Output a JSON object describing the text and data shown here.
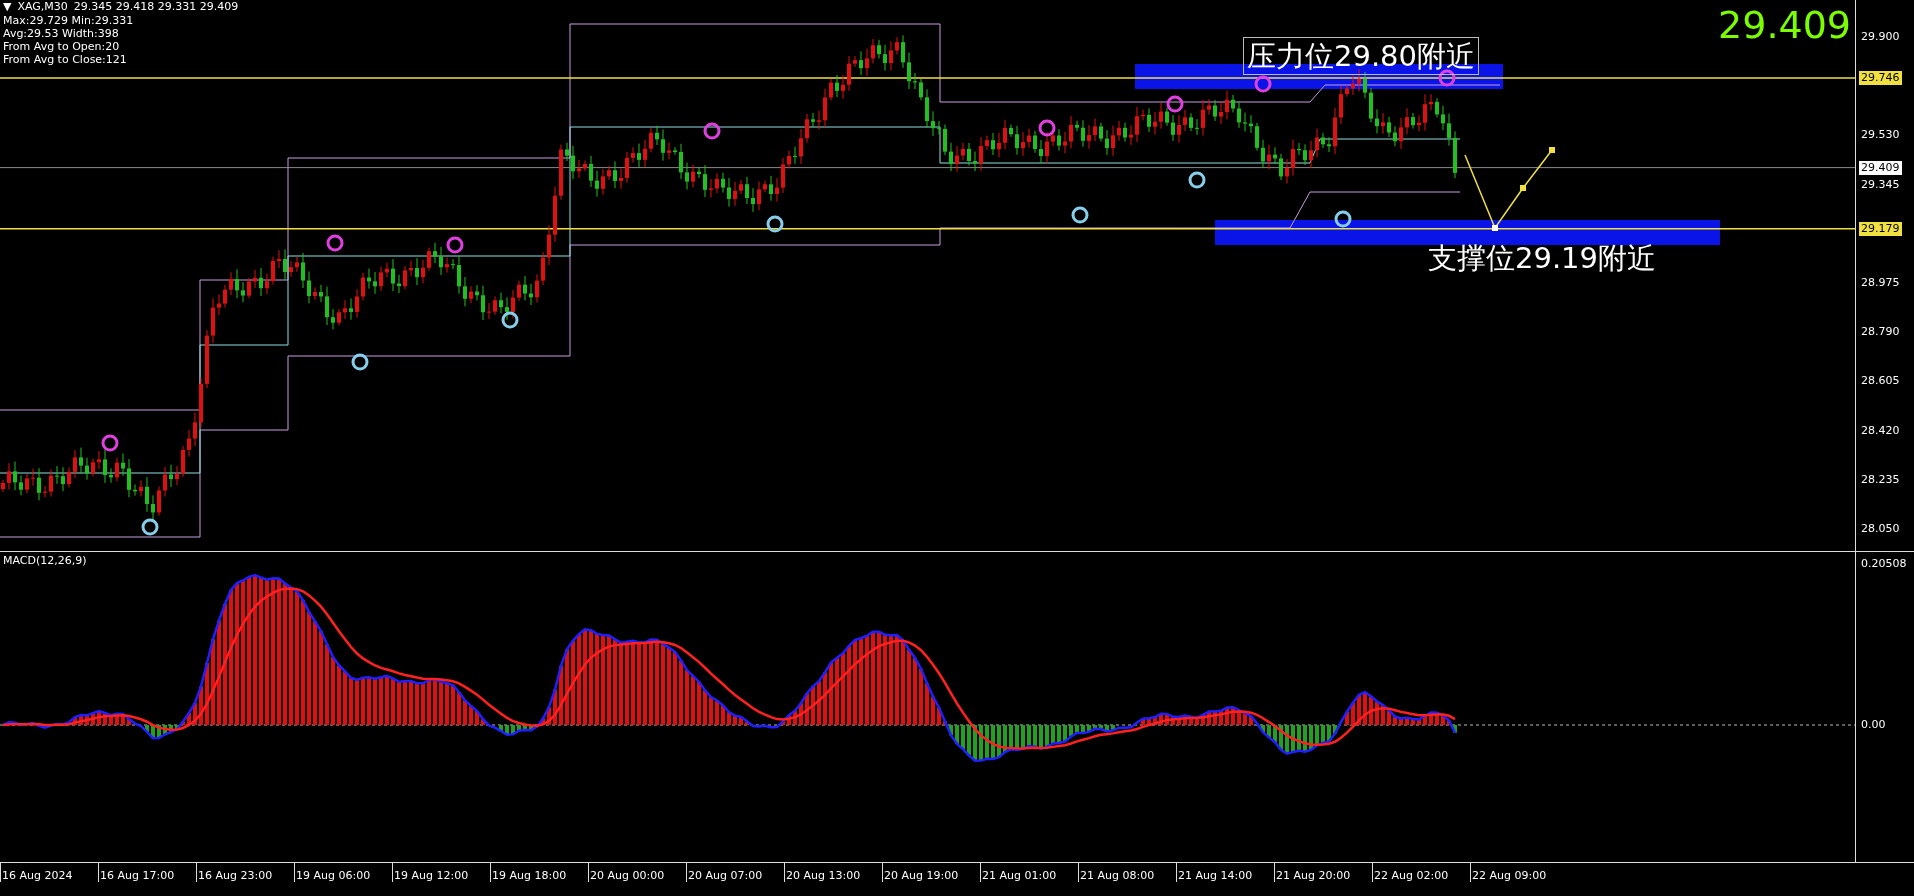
{
  "header": {
    "glyph": "▼",
    "symbol": "XAG,M30",
    "ohlc": "29.345 29.418 29.331 29.409"
  },
  "info_lines": [
    "Max:29.729 Min:29.331",
    "Avg:29.53 Width:398",
    "From Avg to Open:20",
    "From Avg to Close:121"
  ],
  "last_price": "29.409",
  "annotations": [
    {
      "kind": "resistance",
      "text": "压力位29.80附近"
    },
    {
      "kind": "support",
      "text": "支撑位29.19附近"
    }
  ],
  "price_axis": [
    {
      "text": "29.900",
      "kind": "tick"
    },
    {
      "text": "29.746",
      "kind": "level_tag"
    },
    {
      "text": "29.530",
      "kind": "tick"
    },
    {
      "text": "29.409",
      "kind": "price_tag"
    },
    {
      "text": "29.345",
      "kind": "tick"
    },
    {
      "text": "29.179",
      "kind": "level_tag"
    },
    {
      "text": "28.975",
      "kind": "tick"
    },
    {
      "text": "28.790",
      "kind": "tick"
    },
    {
      "text": "28.605",
      "kind": "tick"
    },
    {
      "text": "28.420",
      "kind": "tick"
    },
    {
      "text": "28.235",
      "kind": "tick"
    },
    {
      "text": "28.050",
      "kind": "tick"
    }
  ],
  "macd": {
    "label": "MACD(12,26,9)",
    "axis": [
      "0.20508",
      "0.00"
    ]
  },
  "time_axis": [
    "16 Aug 2024",
    "16 Aug 17:00",
    "16 Aug 23:00",
    "19 Aug 06:00",
    "19 Aug 12:00",
    "19 Aug 18:00",
    "20 Aug 00:00",
    "20 Aug 07:00",
    "20 Aug 13:00",
    "20 Aug 19:00",
    "21 Aug 01:00",
    "21 Aug 08:00",
    "21 Aug 14:00",
    "21 Aug 20:00",
    "22 Aug 02:00",
    "22 Aug 09:00"
  ]
}
